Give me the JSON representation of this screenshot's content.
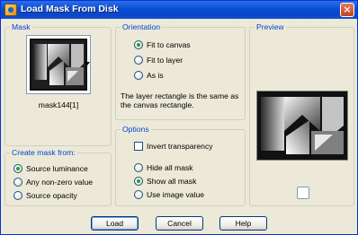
{
  "window": {
    "title": "Load Mask From Disk",
    "close_glyph": "×"
  },
  "mask": {
    "legend": "Mask",
    "file_name": "mask144[1]"
  },
  "orientation": {
    "legend": "Orientation",
    "options": [
      {
        "label": "Fit to canvas",
        "selected": true
      },
      {
        "label": "Fit to layer",
        "selected": false
      },
      {
        "label": "As is",
        "selected": false
      }
    ],
    "note": "The layer rectangle is the same as the canvas rectangle."
  },
  "create_from": {
    "legend": "Create mask from:",
    "options": [
      {
        "label": "Source luminance",
        "selected": true
      },
      {
        "label": "Any non-zero value",
        "selected": false
      },
      {
        "label": "Source opacity",
        "selected": false
      }
    ]
  },
  "options": {
    "legend": "Options",
    "invert_label": "Invert transparency",
    "invert_checked": false,
    "modes": [
      {
        "label": "Hide all mask",
        "selected": false
      },
      {
        "label": "Show all mask",
        "selected": true
      },
      {
        "label": "Use image value",
        "selected": false
      }
    ]
  },
  "preview": {
    "legend": "Preview",
    "auto_preview_checked": false
  },
  "buttons": {
    "load": "Load",
    "cancel": "Cancel",
    "help": "Help"
  },
  "icons": {
    "app": "mask-app-icon",
    "close": "close-icon",
    "dropdown": "chevron-down-icon"
  }
}
